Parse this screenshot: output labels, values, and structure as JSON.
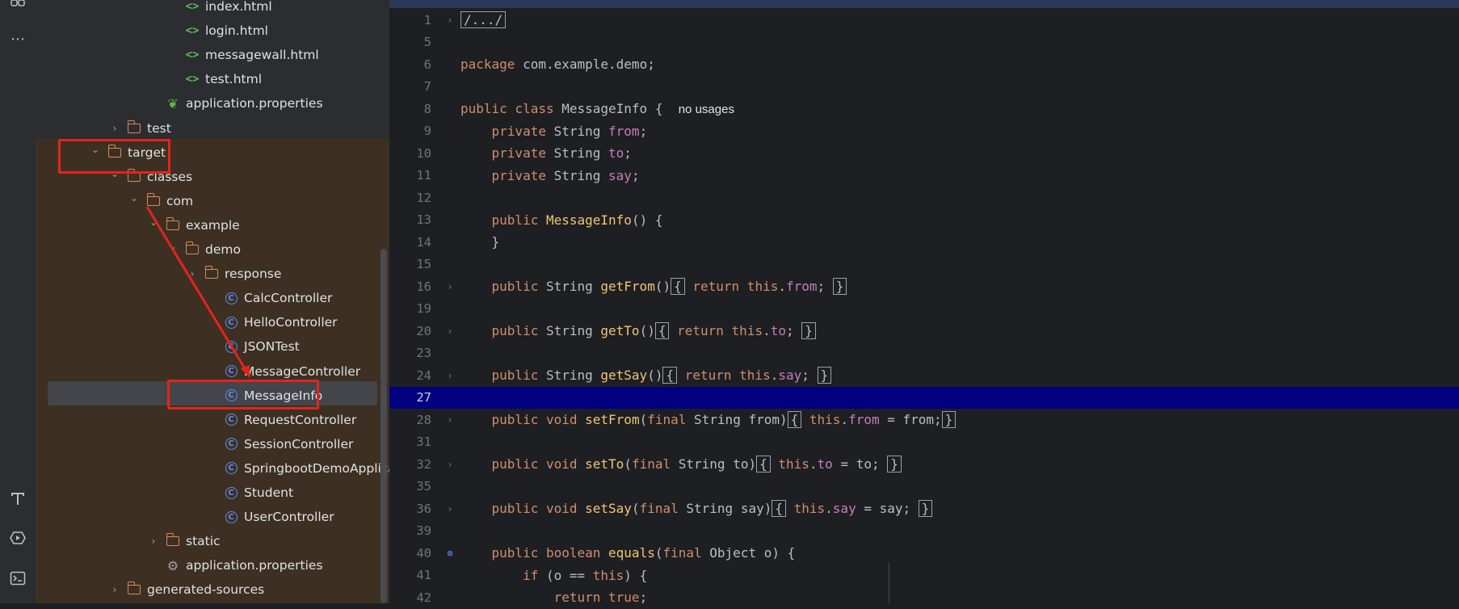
{
  "activity_bar": {
    "icons": [
      "layout-icon",
      "more-icon",
      "build-icon",
      "services-icon",
      "terminal-icon"
    ]
  },
  "tree": {
    "items": [
      {
        "label": "index.html",
        "type": "html",
        "indent": 4,
        "chev": ""
      },
      {
        "label": "login.html",
        "type": "html",
        "indent": 4,
        "chev": ""
      },
      {
        "label": "messagewall.html",
        "type": "html",
        "indent": 4,
        "chev": ""
      },
      {
        "label": "test.html",
        "type": "html",
        "indent": 4,
        "chev": ""
      },
      {
        "label": "application.properties",
        "type": "spring",
        "indent": 3,
        "chev": ""
      },
      {
        "label": "test",
        "type": "folder",
        "indent": 1,
        "chev": "›"
      },
      {
        "label": "target",
        "type": "folder",
        "indent": 0,
        "chev": "⌄"
      },
      {
        "label": "classes",
        "type": "folder",
        "indent": 1,
        "chev": "⌄"
      },
      {
        "label": "com",
        "type": "folder",
        "indent": 2,
        "chev": "⌄"
      },
      {
        "label": "example",
        "type": "folder",
        "indent": 3,
        "chev": "⌄"
      },
      {
        "label": "demo",
        "type": "folder",
        "indent": 4,
        "chev": "⌄"
      },
      {
        "label": "response",
        "type": "folder",
        "indent": 5,
        "chev": "›"
      },
      {
        "label": "CalcController",
        "type": "class",
        "indent": 6,
        "chev": ""
      },
      {
        "label": "HelloController",
        "type": "class",
        "indent": 6,
        "chev": ""
      },
      {
        "label": "JSONTest",
        "type": "class",
        "indent": 6,
        "chev": ""
      },
      {
        "label": "MessageController",
        "type": "class",
        "indent": 6,
        "chev": ""
      },
      {
        "label": "MessageInfo",
        "type": "class",
        "indent": 6,
        "chev": ""
      },
      {
        "label": "RequestController",
        "type": "class",
        "indent": 6,
        "chev": ""
      },
      {
        "label": "SessionController",
        "type": "class",
        "indent": 6,
        "chev": ""
      },
      {
        "label": "SpringbootDemoApplication",
        "type": "class",
        "indent": 6,
        "chev": ""
      },
      {
        "label": "Student",
        "type": "class",
        "indent": 6,
        "chev": ""
      },
      {
        "label": "UserController",
        "type": "class",
        "indent": 6,
        "chev": ""
      },
      {
        "label": "static",
        "type": "folder",
        "indent": 3,
        "chev": "›"
      },
      {
        "label": "application.properties",
        "type": "gear",
        "indent": 3,
        "chev": ""
      },
      {
        "label": "generated-sources",
        "type": "folder",
        "indent": 1,
        "chev": "›"
      }
    ]
  },
  "editor": {
    "lines": [
      {
        "n": "1",
        "fold": "›",
        "html": "<span class='box'>/.../</span>"
      },
      {
        "n": "5",
        "fold": "",
        "html": ""
      },
      {
        "n": "6",
        "fold": "",
        "html": "<span class='kw'>package</span> com.example.demo;"
      },
      {
        "n": "7",
        "fold": "",
        "html": ""
      },
      {
        "n": "8",
        "fold": "",
        "html": "<span class='kw'>public class</span> MessageInfo {  <span class='hint'>no usages</span>"
      },
      {
        "n": "9",
        "fold": "",
        "html": "    <span class='kw'>private</span> String <span class='fld'>from</span>;"
      },
      {
        "n": "10",
        "fold": "",
        "html": "    <span class='kw'>private</span> String <span class='fld'>to</span>;"
      },
      {
        "n": "11",
        "fold": "",
        "html": "    <span class='kw'>private</span> String <span class='fld'>say</span>;"
      },
      {
        "n": "12",
        "fold": "",
        "html": ""
      },
      {
        "n": "13",
        "fold": "",
        "html": "    <span class='kw'>public</span> <span class='mth'>MessageInfo</span>() {"
      },
      {
        "n": "14",
        "fold": "",
        "html": "    }"
      },
      {
        "n": "15",
        "fold": "",
        "html": ""
      },
      {
        "n": "16",
        "fold": "›",
        "html": "    <span class='kw'>public</span> String <span class='mth'>getFrom</span>()<span class='box'>{</span> <span class='kw'>return this</span>.<span class='fld'>from</span>; <span class='box'>}</span>"
      },
      {
        "n": "19",
        "fold": "",
        "html": ""
      },
      {
        "n": "20",
        "fold": "›",
        "html": "    <span class='kw'>public</span> String <span class='mth'>getTo</span>()<span class='box'>{</span> <span class='kw'>return this</span>.<span class='fld'>to</span>; <span class='box'>}</span>"
      },
      {
        "n": "23",
        "fold": "",
        "html": ""
      },
      {
        "n": "24",
        "fold": "›",
        "html": "    <span class='kw'>public</span> String <span class='mth'>getSay</span>()<span class='box'>{</span> <span class='kw'>return this</span>.<span class='fld'>say</span>; <span class='box'>}</span>"
      },
      {
        "n": "27",
        "fold": "",
        "html": "",
        "current": true
      },
      {
        "n": "28",
        "fold": "›",
        "html": "    <span class='kw'>public void</span> <span class='mth'>setFrom</span>(<span class='kw'>final</span> String from)<span class='box'>{</span> <span class='kw'>this</span>.<span class='fld'>from</span> = from;<span class='box'>}</span>"
      },
      {
        "n": "31",
        "fold": "",
        "html": ""
      },
      {
        "n": "32",
        "fold": "›",
        "html": "    <span class='kw'>public void</span> <span class='mth'>setTo</span>(<span class='kw'>final</span> String to)<span class='box'>{</span> <span class='kw'>this</span>.<span class='fld'>to</span> = to; <span class='box'>}</span>"
      },
      {
        "n": "35",
        "fold": "",
        "html": ""
      },
      {
        "n": "36",
        "fold": "›",
        "html": "    <span class='kw'>public void</span> <span class='mth'>setSay</span>(<span class='kw'>final</span> String say)<span class='box'>{</span> <span class='kw'>this</span>.<span class='fld'>say</span> = say; <span class='box'>}</span>"
      },
      {
        "n": "39",
        "fold": "",
        "html": ""
      },
      {
        "n": "40",
        "fold": "⊚",
        "html": "    <span class='kw'>public boolean</span> <span class='mth'>equals</span>(<span class='kw'>final</span> Object o) {"
      },
      {
        "n": "41",
        "fold": "",
        "html": "        <span class='kw'>if</span> (o == <span class='kw'>this</span>) {"
      },
      {
        "n": "42",
        "fold": "",
        "html": "            <span class='kw'>return true</span>;"
      }
    ]
  }
}
